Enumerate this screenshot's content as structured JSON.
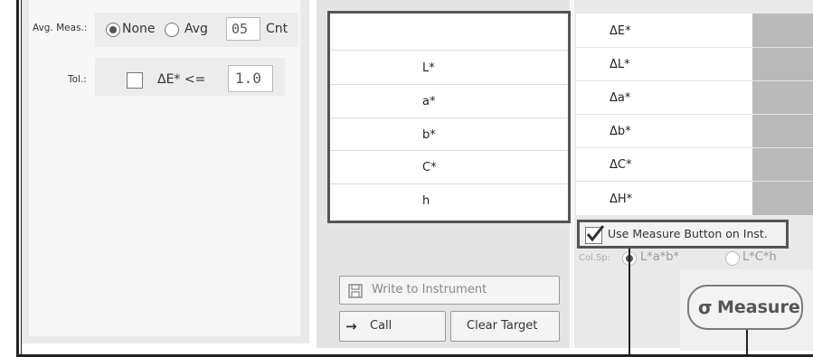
{
  "left_panel": {
    "avg_meas_label": "Avg. Meas.:",
    "options": [
      {
        "label": "None",
        "selected": true
      },
      {
        "label": "Avg",
        "selected": false
      }
    ],
    "count_value": "05",
    "count_unit": "Cnt",
    "tol_label": "Tol.:",
    "tol_expr": "ΔE* <=",
    "tol_value": "1.0"
  },
  "color_values": {
    "rows": [
      "",
      "L*",
      "a*",
      "b*",
      "C*",
      "h"
    ]
  },
  "differences": {
    "rows": [
      "ΔE*",
      "ΔL*",
      "Δa*",
      "Δb*",
      "ΔC*",
      "ΔH*"
    ]
  },
  "controls": {
    "use_measure_button_label": "Use Measure Button on Inst.",
    "use_measure_button_checked": true,
    "color_space_label": "Col.Sp:",
    "color_space_options": [
      {
        "label": "L*a*b*",
        "selected": true
      },
      {
        "label": "L*C*h",
        "selected": false
      }
    ],
    "write_to_instrument_label": "Write to Instrument",
    "call_label": "Call",
    "clear_target_label": "Clear Target",
    "measure_label": "Measure"
  }
}
